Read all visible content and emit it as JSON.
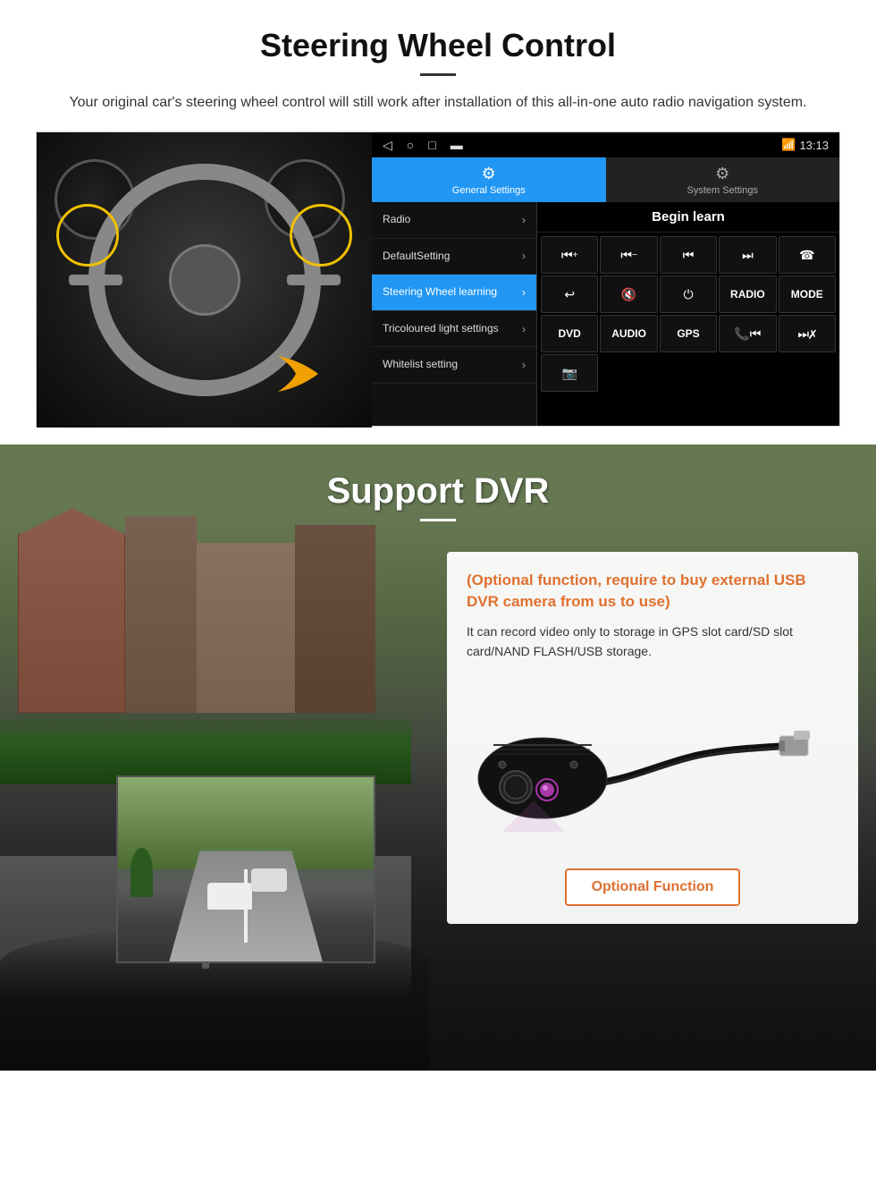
{
  "page": {
    "sections": {
      "steering": {
        "title": "Steering Wheel Control",
        "description": "Your original car's steering wheel control will still work after installation of this all-in-one auto radio navigation system."
      },
      "dvr": {
        "title": "Support DVR",
        "optional_heading": "(Optional function, require to buy external USB DVR camera from us to use)",
        "description": "It can record video only to storage in GPS slot card/SD slot card/NAND FLASH/USB storage.",
        "optional_button": "Optional Function"
      }
    },
    "android_ui": {
      "statusbar": {
        "time": "13:13",
        "signal_icon": "▾",
        "wifi_icon": "▾"
      },
      "tabs": [
        {
          "label": "General Settings",
          "icon": "⚙"
        },
        {
          "label": "System Settings",
          "icon": "⚙"
        }
      ],
      "menu_items": [
        {
          "label": "Radio",
          "active": false
        },
        {
          "label": "DefaultSetting",
          "active": false
        },
        {
          "label": "Steering Wheel learning",
          "active": true
        },
        {
          "label": "Tricoloured light settings",
          "active": false
        },
        {
          "label": "Whitelist setting",
          "active": false
        }
      ],
      "begin_learn_label": "Begin learn",
      "control_buttons": [
        "⏮+",
        "⏮−",
        "⏮⏮",
        "⏭⏭",
        "☎",
        "↩",
        "🔇",
        "⏻",
        "RADIO",
        "MODE",
        "DVD",
        "AUDIO",
        "GPS",
        "📞⏮",
        "⏭✗"
      ]
    }
  }
}
